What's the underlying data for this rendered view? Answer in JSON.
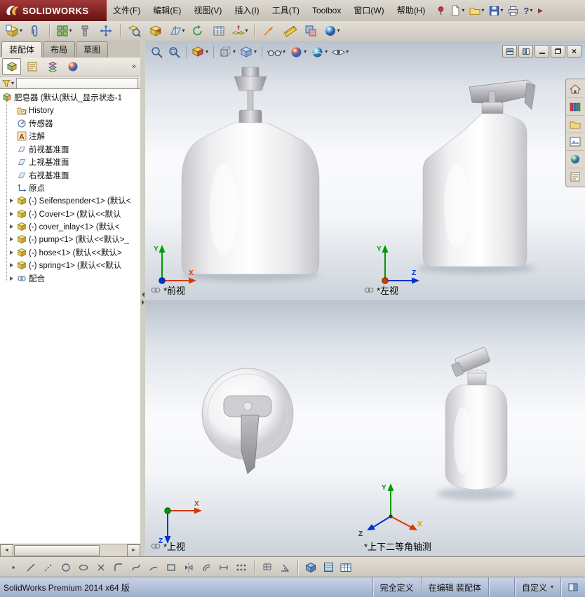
{
  "icons": {
    "caret": "▾",
    "chevrons": "»",
    "question": "?",
    "close": "×",
    "letter_a": "A",
    "left": "◄",
    "right": "►"
  },
  "titlebar": {
    "logo": "SOLIDWORKS",
    "menus": [
      "文件(F)",
      "编辑(E)",
      "视图(V)",
      "插入(I)",
      "工具(T)",
      "Toolbox",
      "窗口(W)",
      "帮助(H)"
    ]
  },
  "panel": {
    "tabs": [
      "装配体",
      "布局",
      "草图"
    ],
    "tree": [
      {
        "label": "肥皂器 (默认(默认_显示状态-1"
      },
      {
        "label": "History"
      },
      {
        "label": "传感器"
      },
      {
        "label": "注解"
      },
      {
        "label": "前视基准面"
      },
      {
        "label": "上视基准面"
      },
      {
        "label": "右视基准面"
      },
      {
        "label": "原点"
      },
      {
        "label": "(-) Seifenspender<1> (默认<"
      },
      {
        "label": "(-) Cover<1> (默认<<默认"
      },
      {
        "label": "(-) cover_inlay<1> (默认<"
      },
      {
        "label": "(-) pump<1> (默认<<默认>_"
      },
      {
        "label": "(-) hose<1> (默认<<默认>"
      },
      {
        "label": "(-) spring<1> (默认<<默认"
      },
      {
        "label": "配合"
      }
    ]
  },
  "viewports": {
    "front": "*前视",
    "left": "*左视",
    "top": "*上视",
    "iso": "*上下二等角轴测"
  },
  "axis": {
    "x": "X",
    "y": "Y",
    "z": "Z"
  },
  "statusbar": {
    "product": "SolidWorks Premium 2014 x64 版",
    "defined": "完全定义",
    "editing": "在编辑 装配体",
    "custom": "自定义"
  }
}
